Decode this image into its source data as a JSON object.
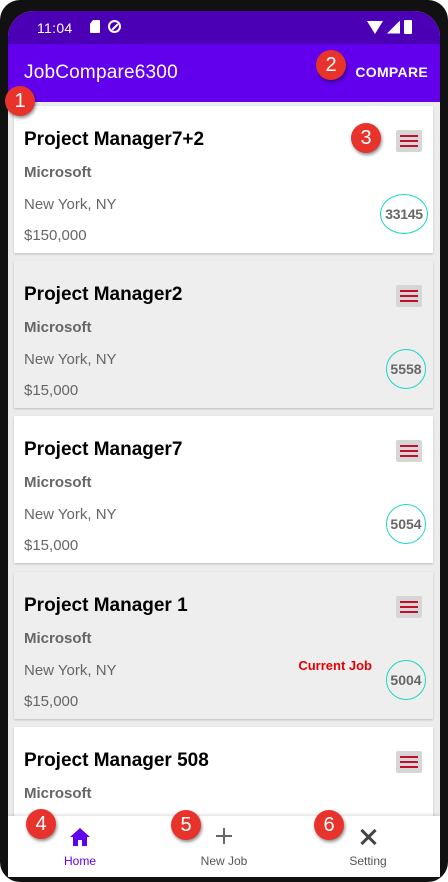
{
  "status_bar": {
    "time": "11:04"
  },
  "app_bar": {
    "title": "JobCompare6300",
    "compare_label": "COMPARE"
  },
  "jobs": [
    {
      "title": "Project Manager7+2",
      "company": "Microsoft",
      "location": "New York, NY",
      "salary": "$150,000",
      "score": "33145",
      "current_label": ""
    },
    {
      "title": "Project Manager2",
      "company": "Microsoft",
      "location": "New York, NY",
      "salary": "$15,000",
      "score": "5558",
      "current_label": ""
    },
    {
      "title": "Project Manager7",
      "company": "Microsoft",
      "location": "New York, NY",
      "salary": "$15,000",
      "score": "5054",
      "current_label": ""
    },
    {
      "title": "Project Manager 1",
      "company": "Microsoft",
      "location": "New York, NY",
      "salary": "$15,000",
      "score": "5004",
      "current_label": "Current Job"
    },
    {
      "title": "Project Manager 508",
      "company": "Microsoft",
      "location": "",
      "salary": "",
      "score": "",
      "current_label": ""
    }
  ],
  "bottom_nav": {
    "home_label": "Home",
    "new_job_label": "New Job",
    "setting_label": "Setting"
  },
  "markers": [
    "1",
    "2",
    "3",
    "4",
    "5",
    "6"
  ],
  "colors": {
    "app_bar": "#6200ee",
    "status_bar": "#4b00b5",
    "score_ring": "#1ad7c4",
    "current_job": "#e60000",
    "marker": "#e8322c"
  },
  "icons": {
    "home": "home-icon",
    "new_job": "plus-icon",
    "setting": "tools-icon",
    "card_menu": "hamburger-icon"
  }
}
